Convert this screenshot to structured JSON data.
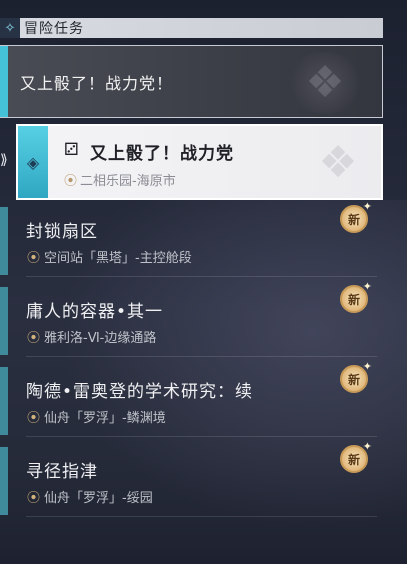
{
  "header": {
    "title": "冒险任务",
    "icon": "diamond-icon"
  },
  "category": {
    "title": "又上骰了！战力党！"
  },
  "selected_quest": {
    "icon": "dice-icon",
    "title": "又上骰了！战力党",
    "location": "二相乐园-海原市"
  },
  "quests": [
    {
      "title": "封锁扇区",
      "location": "空间站「黑塔」-主控舱段",
      "badge": "新"
    },
    {
      "title": "庸人的容器•其一",
      "location": "雅利洛-Ⅵ-边缘通路",
      "badge": "新"
    },
    {
      "title": "陶德•雷奥登的学术研究：续",
      "location": "仙舟「罗浮」-鳞渊境",
      "badge": "新"
    },
    {
      "title": "寻径指津",
      "location": "仙舟「罗浮」-绥园",
      "badge": "新"
    }
  ],
  "colors": {
    "accent": "#45c1d8",
    "badge": "#e0b77a",
    "pin": "#d2b27d"
  }
}
